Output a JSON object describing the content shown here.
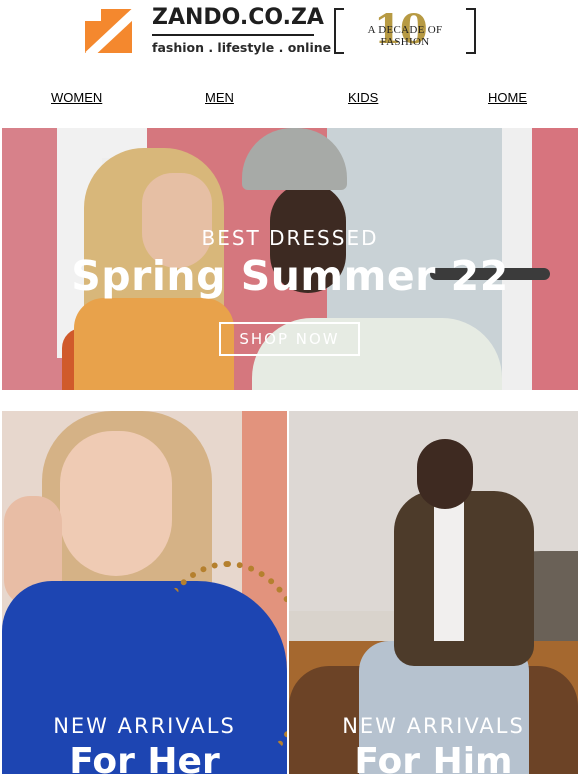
{
  "brand": {
    "name": "ZANDO.CO.ZA",
    "tagline": "fashion . lifestyle . online",
    "badge_text": "A DECADE OF FASHION",
    "badge_number": "10",
    "accent_color": "#f4882e",
    "gold_color": "#b79a43"
  },
  "nav": {
    "items": [
      {
        "label": "WOMEN"
      },
      {
        "label": "MEN"
      },
      {
        "label": "KIDS"
      },
      {
        "label": "HOME"
      }
    ]
  },
  "hero": {
    "subtitle": "BEST DRESSED",
    "title": "Spring Summer 22",
    "cta_label": "SHOP NOW"
  },
  "tiles": [
    {
      "subtitle": "NEW ARRIVALS",
      "title": "For Her"
    },
    {
      "subtitle": "NEW ARRIVALS",
      "title": "For Him"
    }
  ]
}
